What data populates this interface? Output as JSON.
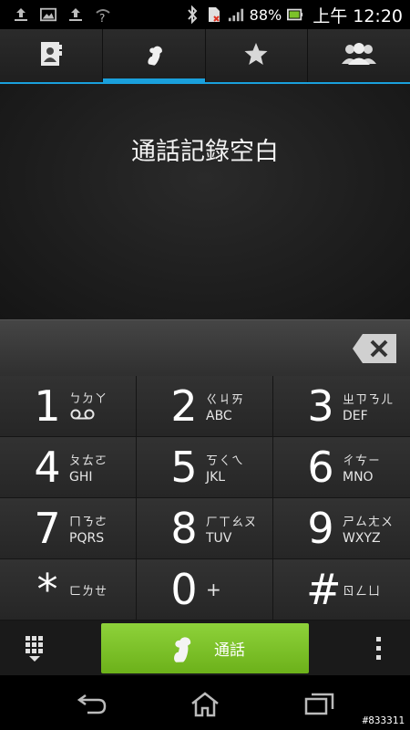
{
  "status_bar": {
    "battery": "88%",
    "time": "上午 12:20",
    "icons": [
      "upload-icon",
      "image-icon",
      "upload-icon",
      "wifi-question-icon",
      "bluetooth-icon",
      "sim-error-icon",
      "signal-icon",
      "battery-icon"
    ]
  },
  "tabs": [
    {
      "icon": "contacts-icon"
    },
    {
      "icon": "phone-icon",
      "active": true
    },
    {
      "icon": "star-icon"
    },
    {
      "icon": "groups-icon"
    }
  ],
  "call_log": {
    "empty_text": "通話記錄空白"
  },
  "keypad": [
    {
      "digit": "1",
      "zh": "ㄅㄉㄚ",
      "en": "",
      "voicemail": true
    },
    {
      "digit": "2",
      "zh": "ㄍㄐㄞ",
      "en": "ABC"
    },
    {
      "digit": "3",
      "zh": "ㄓㄗㄋㄦ",
      "en": "DEF"
    },
    {
      "digit": "4",
      "zh": "ㄆㄊㄛ",
      "en": "GHI"
    },
    {
      "digit": "5",
      "zh": "ㄎㄑㄟ",
      "en": "JKL"
    },
    {
      "digit": "6",
      "zh": "ㄔㄘㄧ",
      "en": "MNO"
    },
    {
      "digit": "7",
      "zh": "ㄇㄋㄜ",
      "en": "PQRS"
    },
    {
      "digit": "8",
      "zh": "ㄏㄒㄠㄡ",
      "en": "TUV"
    },
    {
      "digit": "9",
      "zh": "ㄕㄙㄤㄨ",
      "en": "WXYZ"
    },
    {
      "digit": "*",
      "zh": "ㄈㄌㄝ",
      "en": ""
    },
    {
      "digit": "0",
      "zh": "+",
      "en": ""
    },
    {
      "digit": "#",
      "zh": "ㄖㄥㄩ",
      "en": ""
    }
  ],
  "action_bar": {
    "call_label": "通話"
  },
  "watermark": "#833311",
  "colors": {
    "accent": "#1aa0dc",
    "call_green": "#7cc22a"
  }
}
